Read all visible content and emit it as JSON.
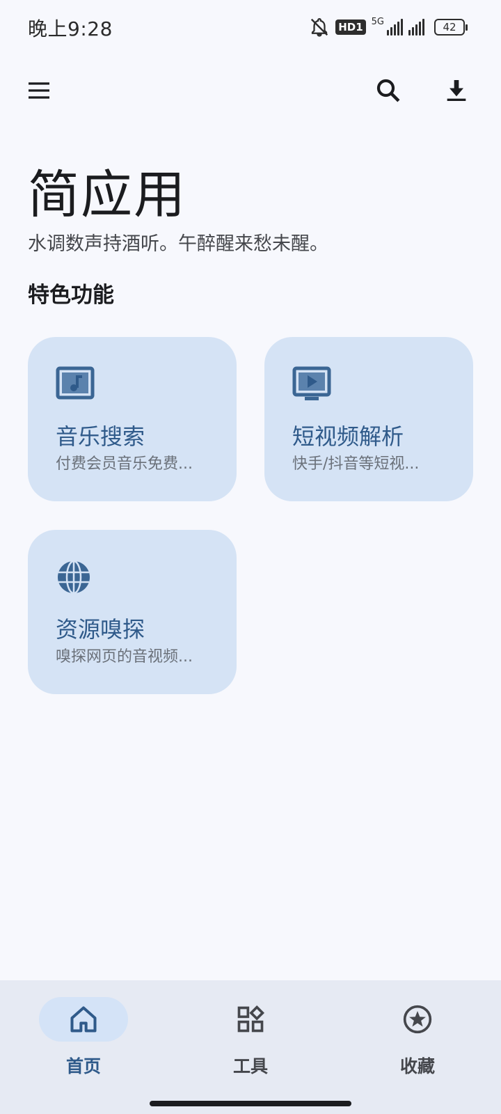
{
  "status_bar": {
    "time": "晚上9:28",
    "network": "HD1",
    "network_type": "5G",
    "battery": "42"
  },
  "top_bar": {
    "icons": [
      "menu-icon",
      "search-icon",
      "download-icon"
    ]
  },
  "page": {
    "title": "简应用",
    "subtitle": "水调数声持酒听。午醉醒来愁未醒。",
    "section_title": "特色功能"
  },
  "features": [
    {
      "title": "音乐搜索",
      "desc": "付费会员音乐免费...",
      "icon": "music-note-icon"
    },
    {
      "title": "短视频解析",
      "desc": "快手/抖音等短视...",
      "icon": "video-play-icon"
    },
    {
      "title": "资源嗅探",
      "desc": "嗅探网页的音视频...",
      "icon": "globe-icon"
    }
  ],
  "bottom_nav": {
    "items": [
      {
        "label": "首页",
        "icon": "home-icon",
        "active": true
      },
      {
        "label": "工具",
        "icon": "widgets-icon",
        "active": false
      },
      {
        "label": "收藏",
        "icon": "star-icon",
        "active": false
      }
    ]
  },
  "colors": {
    "background": "#f7f8fd",
    "card": "#d5e3f5",
    "accent": "#2f5a8a",
    "nav_background": "#e6eaf3"
  }
}
